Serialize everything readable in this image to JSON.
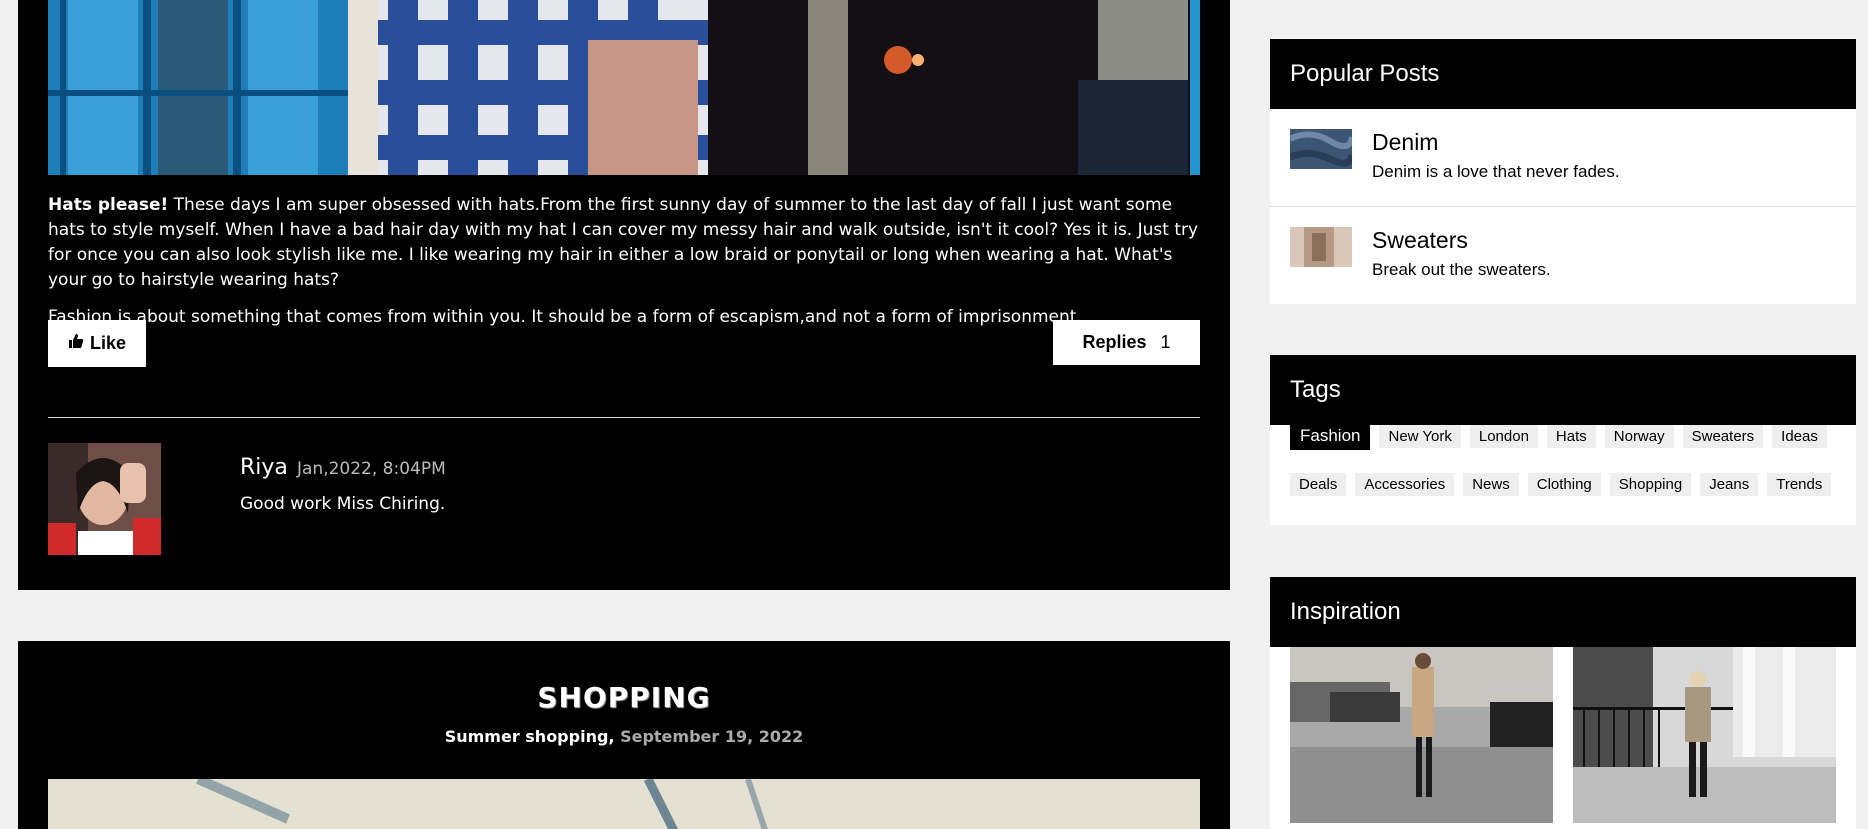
{
  "post": {
    "intro_bold": "Hats please!",
    "paragraph1": "These days I am super obsessed with hats.From the first sunny day of summer to the last day of fall I just want some hats to style myself. When I have a bad hair day with my hat I can cover my messy hair and walk outside, isn't it cool? Yes it is. Just try for once you can also look stylish like me. I like wearing my hair in either a low braid or ponytail or long when wearing a hat. What's your go to hairstyle wearing hats?",
    "paragraph2": "Fashion is about something that comes from within you. It should be a form of escapism,and not a form of imprisonment.",
    "like_label": "Like",
    "replies_label": "Replies",
    "replies_count": "1"
  },
  "comment": {
    "author": "Riya",
    "date": "Jan,2022, 8:04PM",
    "text": "Good work Miss Chiring."
  },
  "post2": {
    "title": "SHOPPING",
    "subtitle": "Summer shopping,",
    "date": "September 19, 2022"
  },
  "sidebar": {
    "popular": {
      "title": "Popular Posts",
      "items": [
        {
          "title": "Denim",
          "desc": "Denim is a love that never fades."
        },
        {
          "title": "Sweaters",
          "desc": "Break out the sweaters."
        }
      ]
    },
    "tags": {
      "title": "Tags",
      "items": [
        "Fashion",
        "New York",
        "London",
        "Hats",
        "Norway",
        "Sweaters",
        "Ideas",
        "Deals",
        "Accessories",
        "News",
        "Clothing",
        "Shopping",
        "Jeans",
        "Trends"
      ]
    },
    "inspiration": {
      "title": "Inspiration"
    }
  },
  "colors": {
    "card_bg": "#000000",
    "page_bg": "#f1f1f1",
    "active_tag": "#000000"
  }
}
